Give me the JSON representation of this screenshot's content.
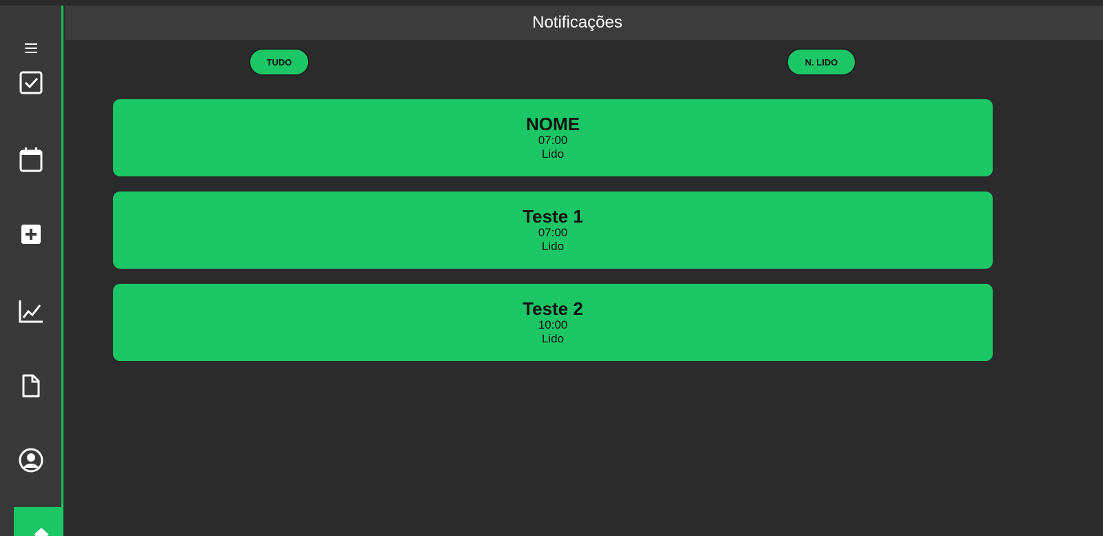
{
  "header": {
    "title": "Notificações"
  },
  "filters": {
    "all_label": "TUDO",
    "unread_label": "N. LIDO"
  },
  "sidebar": {
    "items": [
      {
        "icon": "menu-icon"
      },
      {
        "icon": "checkbox-icon"
      },
      {
        "icon": "calendar-icon"
      },
      {
        "icon": "plus-square-icon"
      },
      {
        "icon": "chart-line-icon"
      },
      {
        "icon": "document-icon"
      },
      {
        "icon": "user-circle-icon"
      },
      {
        "icon": "home-icon"
      }
    ]
  },
  "notifications": [
    {
      "name": "NOME",
      "time": "07:00",
      "status": "Lido"
    },
    {
      "name": "Teste 1",
      "time": "07:00",
      "status": "Lido"
    },
    {
      "name": "Teste 2",
      "time": "10:00",
      "status": "Lido"
    }
  ],
  "colors": {
    "accent": "#1ac666",
    "background": "#2b2b2b",
    "sidebar": "#393939",
    "header": "#3c3c3c"
  }
}
